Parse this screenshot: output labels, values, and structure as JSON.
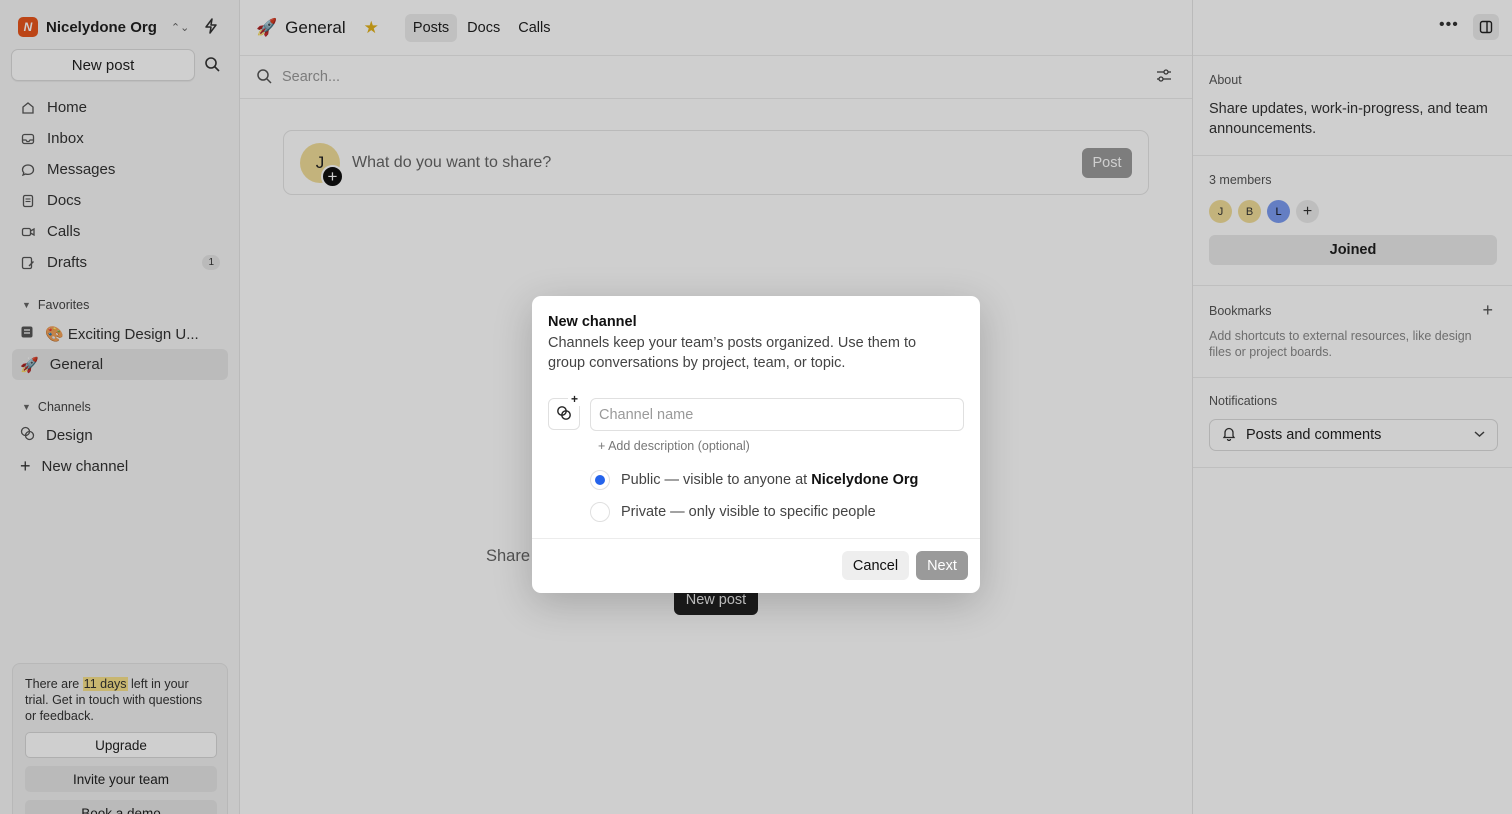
{
  "sidebar": {
    "org_name": "Nicelydone Org",
    "org_logo": "N",
    "new_post": "New post",
    "nav": [
      {
        "label": "Home",
        "icon": "home-icon"
      },
      {
        "label": "Inbox",
        "icon": "inbox-icon"
      },
      {
        "label": "Messages",
        "icon": "message-icon"
      },
      {
        "label": "Docs",
        "icon": "doc-icon"
      },
      {
        "label": "Calls",
        "icon": "video-icon"
      },
      {
        "label": "Drafts",
        "icon": "draft-icon",
        "badge": "1"
      }
    ],
    "favorites_label": "Favorites",
    "favorites": [
      {
        "label": "🎨 Exciting Design U...",
        "icon": "doc-icon"
      },
      {
        "label": "General",
        "icon": "rocket-icon",
        "emoji": "🚀"
      }
    ],
    "channels_label": "Channels",
    "channels": [
      {
        "label": "Design",
        "icon": "design-icon"
      },
      {
        "label": "New channel",
        "icon": "plus-icon"
      }
    ],
    "trial": {
      "before": "There are ",
      "highlight": "11 days",
      "after": " left in your trial. Get in touch with questions or feedback.",
      "upgrade": "Upgrade",
      "invite": "Invite your team",
      "demo": "Book a demo"
    }
  },
  "header": {
    "emoji": "🚀",
    "title": "General",
    "tabs": [
      "Posts",
      "Docs",
      "Calls"
    ],
    "active_tab": "Posts"
  },
  "search": {
    "placeholder": "Search..."
  },
  "composer": {
    "avatar_initial": "J",
    "placeholder": "What do you want to share?",
    "post": "Post"
  },
  "empty": {
    "text": "Share",
    "button": "New post"
  },
  "right_panel": {
    "about_label": "About",
    "about_text": "Share updates, work-in-progress, and team announcements.",
    "members_label": "3 members",
    "members": [
      {
        "initial": "J",
        "color": "#f1dd99"
      },
      {
        "initial": "B",
        "color": "#f1dd99"
      },
      {
        "initial": "L",
        "color": "#7c9cf0"
      }
    ],
    "joined": "Joined",
    "bookmarks_label": "Bookmarks",
    "bookmarks_desc": "Add shortcuts to external resources, like design files or project boards.",
    "notifications_label": "Notifications",
    "notifications_value": "Posts and comments"
  },
  "modal": {
    "title": "New channel",
    "description": "Channels keep your team’s posts organized. Use them to group conversations by project, team, or topic.",
    "name_placeholder": "Channel name",
    "add_description": "+ Add description (optional)",
    "public_label": "Public — visible to anyone at ",
    "public_org": "Nicelydone Org",
    "private_label": "Private — only visible to specific people",
    "selected": "public",
    "cancel": "Cancel",
    "next": "Next"
  },
  "colors": {
    "accent": "#2463eb",
    "brand": "#e8551c",
    "star": "#e3b21b"
  }
}
